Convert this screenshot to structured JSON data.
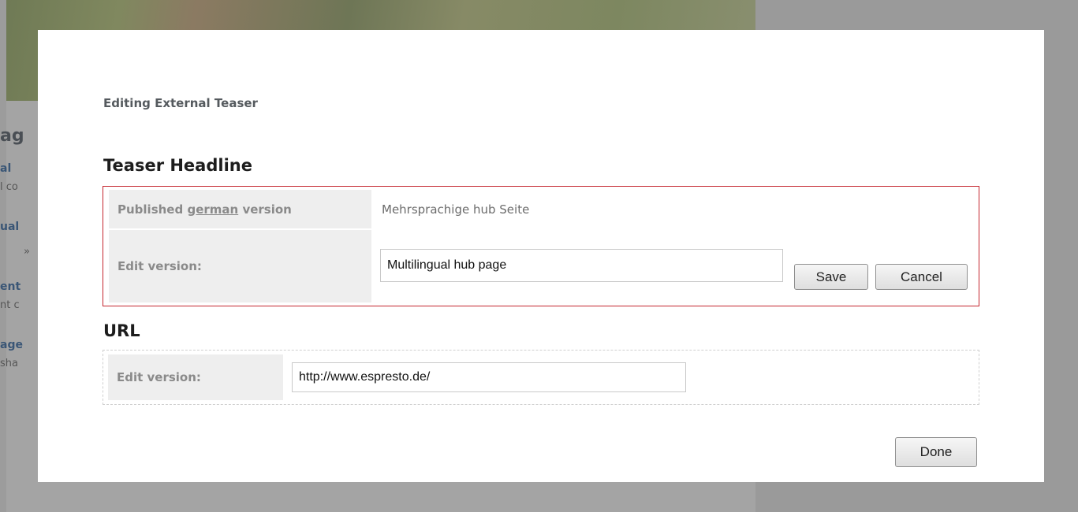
{
  "background": {
    "heading_fragment": "ag",
    "link_fragments": [
      "al",
      "ual",
      "ent",
      "age"
    ],
    "sub_fragments": [
      "l co",
      "»",
      "nt c",
      "sha"
    ]
  },
  "dialog": {
    "title": "Editing External Teaser",
    "headline_section": {
      "title": "Teaser Headline",
      "published_label_prefix": "Published ",
      "published_label_link": "german",
      "published_label_suffix": " version",
      "published_value": "Mehrsprachige hub Seite",
      "edit_label": "Edit version:",
      "edit_value": "Multilingual hub page",
      "save_label": "Save",
      "cancel_label": "Cancel"
    },
    "url_section": {
      "title": "URL",
      "edit_label": "Edit version:",
      "edit_value": "http://www.espresto.de/"
    },
    "done_label": "Done"
  },
  "colors": {
    "error_border": "#c4262e",
    "label_background": "#eeeeee",
    "overlay": "#9a9a9a"
  }
}
